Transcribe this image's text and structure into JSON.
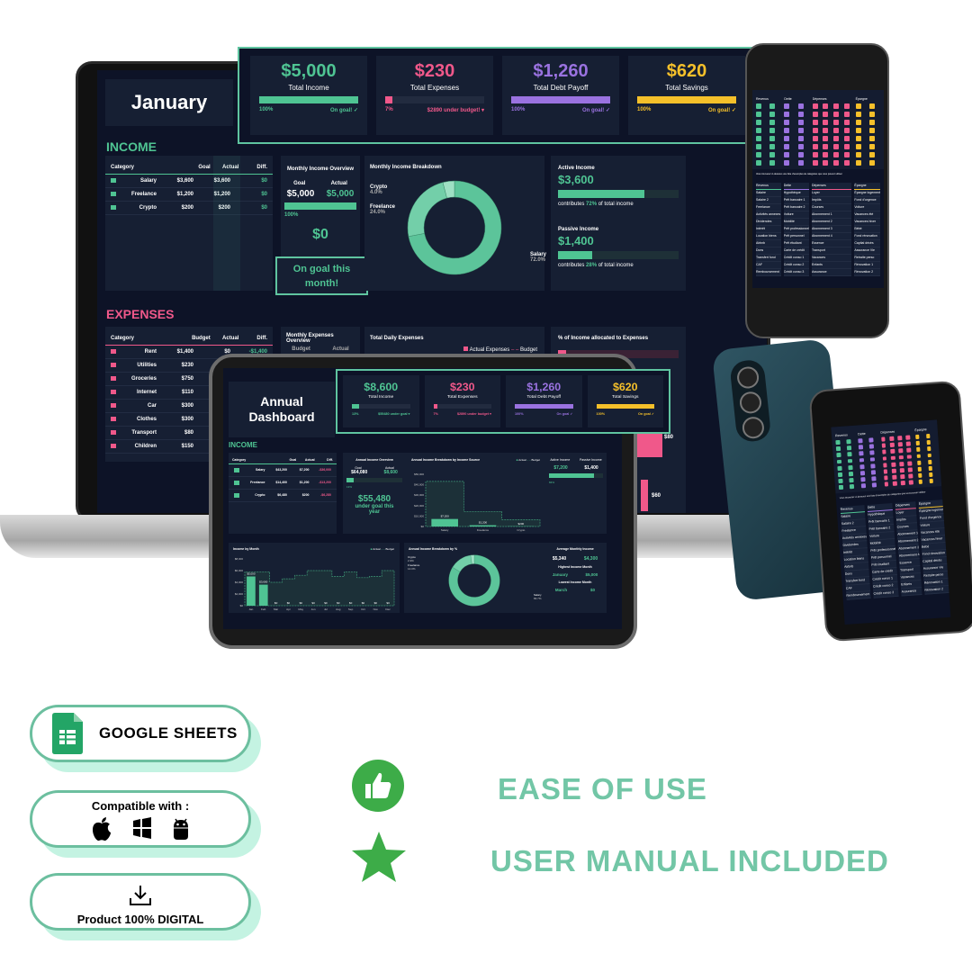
{
  "laptop": {
    "month_title": "January",
    "kpis": [
      {
        "value": "$5,000",
        "label": "Total Income",
        "pct": "100%",
        "status": "On goal! ✓",
        "fill": 100,
        "color": "#4fc493"
      },
      {
        "value": "$230",
        "label": "Total Expenses",
        "pct": "7%",
        "status": "$2890 under budget! ▾",
        "fill": 7,
        "color": "#f0588a"
      },
      {
        "value": "$1,260",
        "label": "Total Debt Payoff",
        "pct": "100%",
        "status": "On goal! ✓",
        "fill": 100,
        "color": "#9a72e0"
      },
      {
        "value": "$620",
        "label": "Total Savings",
        "pct": "100%",
        "status": "On goal! ✓",
        "fill": 100,
        "color": "#f5c02a"
      }
    ],
    "income": {
      "title": "INCOME",
      "headers": [
        "Category",
        "Goal",
        "Actual",
        "Diff."
      ],
      "rows": [
        [
          "Salary",
          "$3,600",
          "$3,600",
          "$0"
        ],
        [
          "Freelance",
          "$1,200",
          "$1,200",
          "$0"
        ],
        [
          "Crypto",
          "$200",
          "$200",
          "$0"
        ]
      ],
      "overview_title": "Monthly Income Overview",
      "goal_label": "Goal",
      "actual_label": "Actual",
      "goal": "$5,000",
      "actual": "$5,000",
      "pct": "100%",
      "diff": "$0",
      "message": "On goal this month!",
      "breakdown_title": "Monthly Income Breakdown",
      "slices": [
        {
          "name": "Salary",
          "pct": "72.0%",
          "value": 72
        },
        {
          "name": "Freelance",
          "pct": "24.0%",
          "value": 24
        },
        {
          "name": "Crypto",
          "pct": "4.0%",
          "value": 4
        }
      ],
      "active_title": "Active Income",
      "active_value": "$3,600",
      "active_pct": "72%",
      "active_fill": 72,
      "passive_title": "Passive Income",
      "passive_value": "$1,400",
      "passive_pct": "28%",
      "passive_fill": 28,
      "contributes": "contributes",
      "of_total": "of total income"
    },
    "expenses": {
      "title": "EXPENSES",
      "headers": [
        "Category",
        "Budget",
        "Actual",
        "Diff."
      ],
      "rows": [
        [
          "Rent",
          "$1,400",
          "$0",
          "-$1,400"
        ],
        [
          "Utilities",
          "$230",
          "",
          ""
        ],
        [
          "Groceries",
          "$750",
          "",
          ""
        ],
        [
          "Internet",
          "$110",
          "",
          ""
        ],
        [
          "Car",
          "$300",
          "",
          ""
        ],
        [
          "Clothes",
          "$300",
          "",
          ""
        ],
        [
          "Transport",
          "$80",
          "",
          ""
        ],
        [
          "Children",
          "$150",
          "",
          ""
        ]
      ],
      "overview_title": "Monthly Expenses Overview",
      "budget_label": "Budget",
      "actual_label": "Actual",
      "daily_title": "Total Daily Expenses",
      "legend_actual": "Actual Expenses",
      "legend_budget": "Budget",
      "alloc_title": "% of Income allocated to Expenses",
      "bar_label_1": "$80",
      "bar_label_2": "$60"
    }
  },
  "tablet": {
    "title": "Annual Dashboard",
    "kpis": [
      {
        "value": "$8,600",
        "label": "Total Income",
        "pct": "13%",
        "status": "$55480 under goal ▾",
        "fill": 13,
        "color": "#4fc493"
      },
      {
        "value": "$230",
        "label": "Total Expenses",
        "pct": "7%",
        "status": "$2890 under budget ▾",
        "fill": 7,
        "color": "#f0588a"
      },
      {
        "value": "$1,260",
        "label": "Total Debt Payoff",
        "pct": "100%",
        "status": "On goal ✓",
        "fill": 100,
        "color": "#9a72e0"
      },
      {
        "value": "$620",
        "label": "Total Savings",
        "pct": "100%",
        "status": "On goal ✓",
        "fill": 100,
        "color": "#f5c02a"
      }
    ],
    "income_title": "INCOME",
    "headers": [
      "Category",
      "Goal",
      "Actual",
      "Diff."
    ],
    "rows": [
      [
        "Salary",
        "$43,200",
        "$7,200",
        "-$36,000"
      ],
      [
        "Freelance",
        "$14,400",
        "$1,200",
        "-$13,200"
      ],
      [
        "Crypto",
        "$6,480",
        "$200",
        "-$6,280"
      ]
    ],
    "overview_title": "Annual Income Overview",
    "goal_label": "Goal",
    "actual_label": "Actual",
    "goal": "$64,080",
    "actual": "$8,600",
    "pct": "13%",
    "diff": "$55,480",
    "message": "under goal this year",
    "source_title": "Annual Income Breakdown by Income Source",
    "legend_actual": "Actual",
    "legend_budget": "Budget",
    "source_chart": {
      "type": "bar",
      "categories": [
        "Salary",
        "Freelance",
        "Crypto"
      ],
      "actual": [
        7200,
        1200,
        200
      ],
      "budget": [
        43200,
        14400,
        6480
      ],
      "bar_labels": [
        "$7,200",
        "$1,200",
        "$200"
      ],
      "yticks": [
        "$0",
        "$10,000",
        "$20,000",
        "$30,000",
        "$40,000",
        "$50,000"
      ]
    },
    "active_title": "Active Income",
    "passive_title": "Passive Income",
    "active_value": "$7,200",
    "passive_value": "$1,400",
    "active_pct": "84%",
    "active_fill": 84,
    "month_title": "Income by Month",
    "month_chart": {
      "type": "bar",
      "categories": [
        "Jan",
        "Feb",
        "Mar",
        "Apr",
        "May",
        "Jun",
        "Jul",
        "Aug",
        "Sep",
        "Oct",
        "Nov",
        "Dec"
      ],
      "actual": [
        5000,
        3600,
        0,
        0,
        0,
        0,
        0,
        0,
        0,
        0,
        0,
        0
      ],
      "labels": [
        "$5,000",
        "$3,600",
        "$0",
        "$0",
        "$0",
        "$0",
        "$0",
        "$0",
        "$0",
        "$0",
        "$0",
        "$0"
      ],
      "budget": [
        5800,
        5800,
        4000,
        4600,
        5200,
        6000,
        6000,
        5000,
        5800,
        4800,
        5000,
        6000
      ],
      "yticks": [
        "$0",
        "$2,000",
        "$4,000",
        "$6,000",
        "$8,000"
      ]
    },
    "pct_title": "Annual Income Breakdown by %",
    "slices": [
      {
        "name": "Salary",
        "pct": "83.7%",
        "value": 83.7
      },
      {
        "name": "Freelance",
        "pct": "14.0%",
        "value": 14
      },
      {
        "name": "Crypto",
        "pct": "2.3%",
        "value": 2.3
      }
    ],
    "avg_title": "Average Monthly Income",
    "avg_goal": "$5,340",
    "avg_actual": "$4,300",
    "high_title": "Highest Income Month",
    "high_month": "January",
    "high_value": "$5,000",
    "low_title": "Lowest Income Month",
    "low_month": "March",
    "low_value": "$0"
  },
  "phone": {
    "headers": [
      "Revenus",
      "Dette",
      "Dépenses",
      "Épargne"
    ],
    "note": "Vous trouverez ci-dessous une liste d'exemples de catégories que vous pouvez utiliser",
    "icon_colors": [
      "#4fc493",
      "#9a72e0",
      "#f0588a",
      "#f5c02a"
    ],
    "lists": [
      [
        "Salaire",
        "Salaire 2",
        "Freelance",
        "Activités annexes",
        "Dividendes",
        "Intérêt",
        "Location biens",
        "Airbnb",
        "Dons",
        "Transfert fond",
        "CAF",
        "Remboursement"
      ],
      [
        "Hypothèque",
        "Prêt bancaire 1",
        "Prêt bancaire 2",
        "Voiture",
        "Mobilité",
        "Prêt professionnel",
        "Prêt personnel",
        "Prêt étudiant",
        "Carte de crédit",
        "Crédit conso 1",
        "Crédit conso 2",
        "Crédit conso 3"
      ],
      [
        "Loyer",
        "Impôts",
        "Courses",
        "Abonnement 1",
        "Abonnement 2",
        "Abonnement 3",
        "Abonnement 4",
        "Essence",
        "Transport",
        "Vacances",
        "Enfants",
        "Assurance"
      ],
      [
        "Épargne logement",
        "Fond d'urgence",
        "Voiture",
        "Vacances été",
        "Vacances hiver",
        "Bébé",
        "Fond rénovation",
        "Capital décès",
        "Assurance Vie",
        "Retraite perso",
        "Rénovation 1",
        "Rénovation 2"
      ]
    ]
  },
  "badges": {
    "google": "GOOGLE SHEETS",
    "compatible": "Compatible with :",
    "digital": "Product 100% DIGITAL",
    "os_icons": [
      "apple-icon",
      "windows-icon",
      "android-icon"
    ]
  },
  "features": [
    {
      "icon": "thumbs-up-icon",
      "label": "EASE OF USE"
    },
    {
      "icon": "star-icon",
      "label": "USER MANUAL INCLUDED"
    }
  ],
  "colors": {
    "teal": "#4fc493",
    "pink": "#f0588a",
    "purple": "#9a72e0",
    "yellow": "#f5c02a",
    "feature_text": "#72c6a6",
    "badge_fill": "#c4f3e2"
  }
}
